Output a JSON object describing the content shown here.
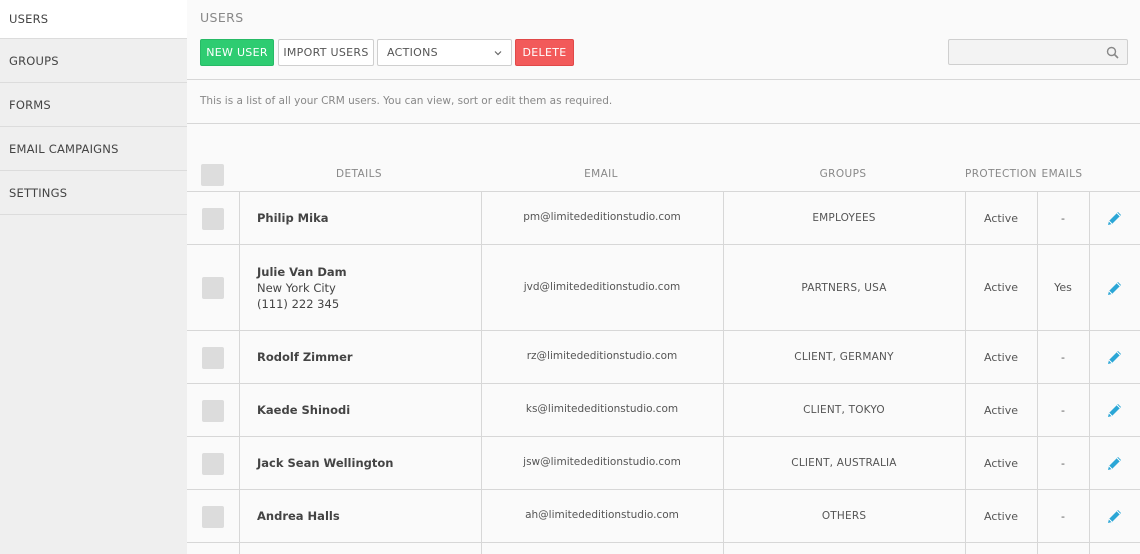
{
  "sidebar": {
    "items": [
      {
        "label": "USERS"
      },
      {
        "label": "GROUPS"
      },
      {
        "label": "FORMS"
      },
      {
        "label": "EMAIL CAMPAIGNS"
      },
      {
        "label": "SETTINGS"
      }
    ]
  },
  "header": {
    "title": "USERS"
  },
  "toolbar": {
    "new_user_label": "NEW USER",
    "import_users_label": "IMPORT USERS",
    "actions_label": "ACTIONS",
    "delete_label": "DELETE"
  },
  "search": {
    "value": "",
    "icon": "search-icon"
  },
  "description": "This is a list of all your CRM users. You can view, sort or edit them as required.",
  "table": {
    "columns": [
      "DETAILS",
      "EMAIL",
      "GROUPS",
      "PROTECTION",
      "EMAILS"
    ],
    "rows": [
      {
        "name": "Philip Mika",
        "city": "",
        "phone": "",
        "email": "pm@limitededitionstudio.com",
        "groups": "EMPLOYEES",
        "protection": "Active",
        "emails": "-"
      },
      {
        "name": "Julie Van Dam",
        "city": "New York City",
        "phone": "(111) 222 345",
        "email": "jvd@limitededitionstudio.com",
        "groups": "PARTNERS, USA",
        "protection": "Active",
        "emails": "Yes"
      },
      {
        "name": "Rodolf Zimmer",
        "city": "",
        "phone": "",
        "email": "rz@limitededitionstudio.com",
        "groups": "CLIENT, GERMANY",
        "protection": "Active",
        "emails": "-"
      },
      {
        "name": "Kaede Shinodi",
        "city": "",
        "phone": "",
        "email": "ks@limitededitionstudio.com",
        "groups": "CLIENT, TOKYO",
        "protection": "Active",
        "emails": "-"
      },
      {
        "name": "Jack Sean Wellington",
        "city": "",
        "phone": "",
        "email": "jsw@limitededitionstudio.com",
        "groups": "CLIENT, AUSTRALIA",
        "protection": "Active",
        "emails": "-"
      },
      {
        "name": "Andrea Halls",
        "city": "",
        "phone": "",
        "email": "ah@limitededitionstudio.com",
        "groups": "OTHERS",
        "protection": "Active",
        "emails": "-"
      }
    ]
  },
  "colors": {
    "new_user": "#2ecc71",
    "delete": "#f25a5a",
    "edit_icon": "#2aa6d6"
  }
}
